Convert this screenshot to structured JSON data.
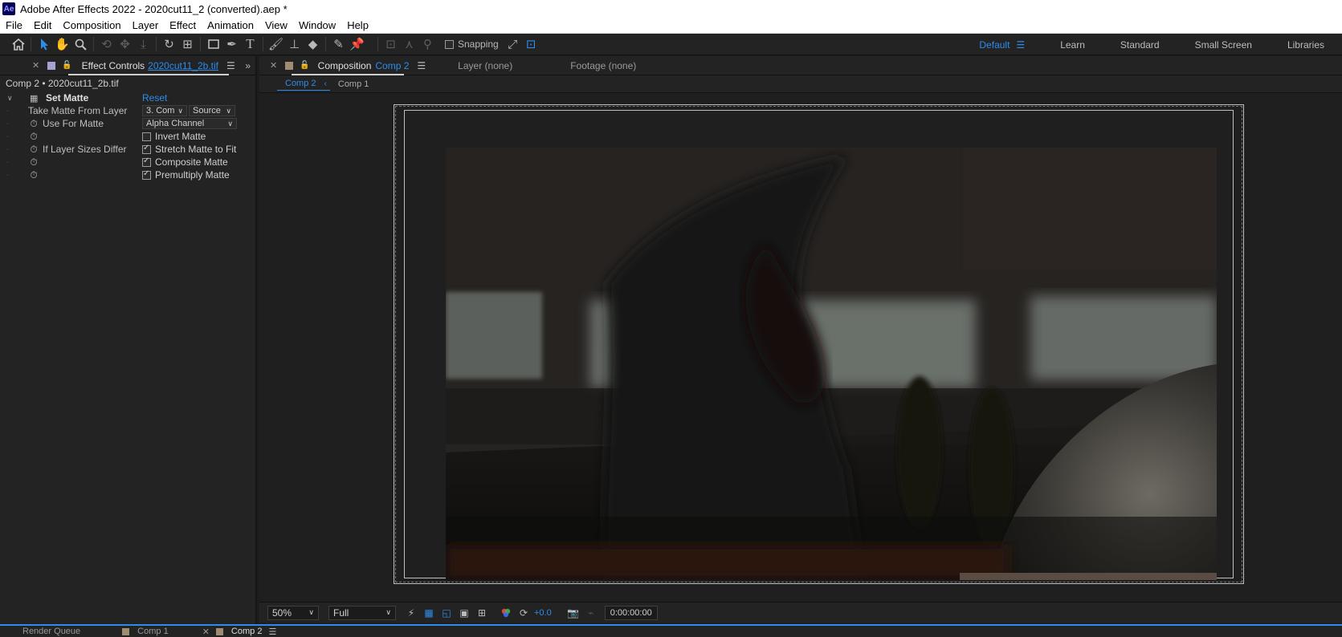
{
  "window": {
    "title": "Adobe After Effects 2022 - 2020cut11_2 (converted).aep *",
    "logo": "Ae"
  },
  "menu": [
    "File",
    "Edit",
    "Composition",
    "Layer",
    "Effect",
    "Animation",
    "View",
    "Window",
    "Help"
  ],
  "toolbar": {
    "tools": [
      "home-icon",
      "selection-tool-icon",
      "hand-tool-icon",
      "zoom-tool-icon",
      "orbit-camera-icon",
      "pan-camera-icon",
      "dolly-camera-icon",
      "rotate-tool-icon",
      "pan-behind-icon",
      "rectangle-tool-icon",
      "pen-tool-icon",
      "type-tool-icon",
      "brush-tool-icon",
      "clone-stamp-icon",
      "eraser-tool-icon",
      "roto-brush-icon",
      "puppet-pin-icon"
    ],
    "snapping_label": "Snapping",
    "snapping_checked": false
  },
  "workspaces": {
    "current": "Default",
    "items": [
      "Learn",
      "Standard",
      "Small Screen",
      "Libraries"
    ]
  },
  "effect_controls": {
    "tab_title": "Effect Controls",
    "tab_file": "2020cut11_2b.tif",
    "breadcrumb": "Comp 2 • 2020cut11_2b.tif",
    "effect_name": "Set Matte",
    "reset_label": "Reset",
    "take_matte_label": "Take Matte From Layer",
    "take_matte_layer": "3. Com",
    "take_matte_source": "Source",
    "use_for_matte_label": "Use For Matte",
    "use_for_matte_value": "Alpha Channel",
    "invert_matte_label": "Invert Matte",
    "invert_matte_checked": false,
    "if_layer_sizes_label": "If Layer Sizes Differ",
    "stretch_label": "Stretch Matte to Fit",
    "stretch_checked": true,
    "composite_label": "Composite Matte",
    "composite_checked": true,
    "premultiply_label": "Premultiply Matte",
    "premultiply_checked": true
  },
  "composition": {
    "tab_label": "Composition",
    "tab_comp": "Comp 2",
    "layer_tab": "Layer  (none)",
    "footage_tab": "Footage  (none)",
    "view_tabs": [
      "Comp 2",
      "Comp 1"
    ],
    "active_view": "Comp 2"
  },
  "viewer": {
    "zoom": "50%",
    "resolution": "Full",
    "exposure": "+0.0",
    "timecode": "0:00:00:00"
  },
  "bottom_tabs": [
    "Render Queue",
    "Comp 1",
    "Comp 2"
  ],
  "colors": {
    "accent": "#2d8ceb",
    "comp1_swatch": "#a08c6e",
    "comp2_swatch": "#a08c6e",
    "effect_swatch": "#a6a2d4"
  }
}
